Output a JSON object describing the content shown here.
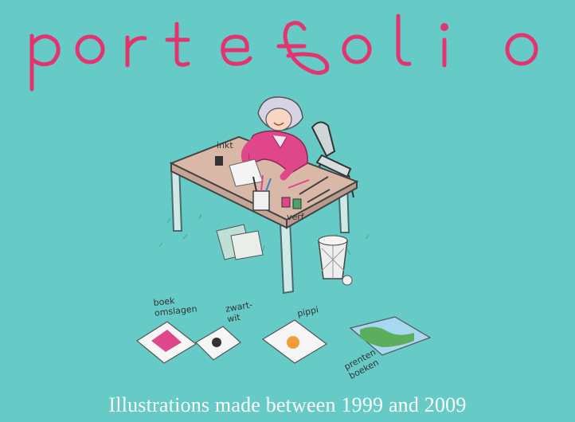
{
  "header": {
    "title": "portefolio"
  },
  "scene": {
    "labels": {
      "ink": "inkt",
      "paint": "verf"
    }
  },
  "sections": [
    {
      "id": "book-covers",
      "label": "boek omslagen"
    },
    {
      "id": "black-white",
      "label": "zwart-wit"
    },
    {
      "id": "pippi",
      "label": "pippi"
    },
    {
      "id": "picture-books",
      "label": "prenten boeken"
    }
  ],
  "footer": {
    "caption": "Illustrations made between 1999 and 2009"
  },
  "colors": {
    "background": "#66cbc6",
    "title": "#e5336f",
    "table_top": "#d9b8a8",
    "sweater": "#e0478a"
  }
}
